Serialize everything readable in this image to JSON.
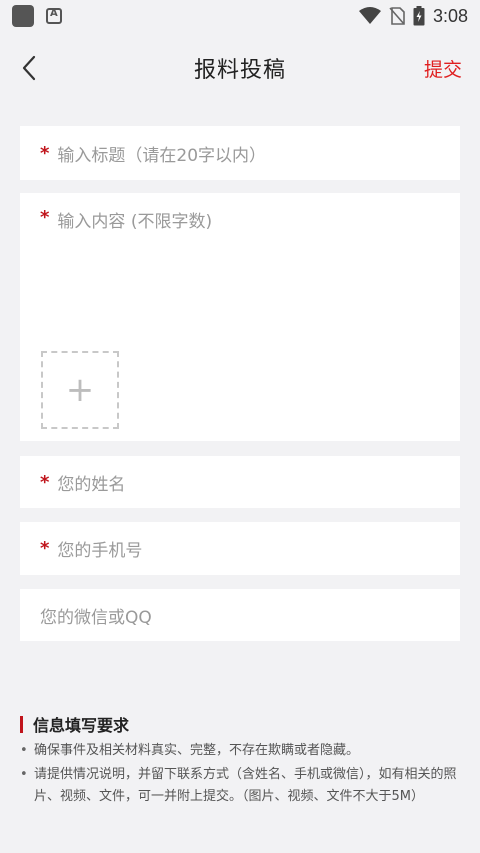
{
  "status_bar": {
    "time": "3:08"
  },
  "header": {
    "title": "报料投稿",
    "submit_label": "提交"
  },
  "form": {
    "required_mark": "*",
    "title_placeholder": "输入标题（请在20字以内）",
    "content_placeholder": "输入内容 (不限字数)",
    "name_placeholder": "您的姓名",
    "phone_placeholder": "您的手机号",
    "wechat_placeholder": "您的微信或QQ",
    "upload_plus": "+"
  },
  "info": {
    "title": "信息填写要求",
    "rules": [
      "确保事件及相关材料真实、完整，不存在欺瞒或者隐藏。",
      "请提供情况说明，并留下联系方式（含姓名、手机或微信），如有相关的照片、视频、文件，可一并附上提交。（图片、视频、文件不大于5M）"
    ]
  },
  "colors": {
    "accent": "#e02020",
    "required": "#c0141b",
    "background": "#f2f2f4"
  }
}
